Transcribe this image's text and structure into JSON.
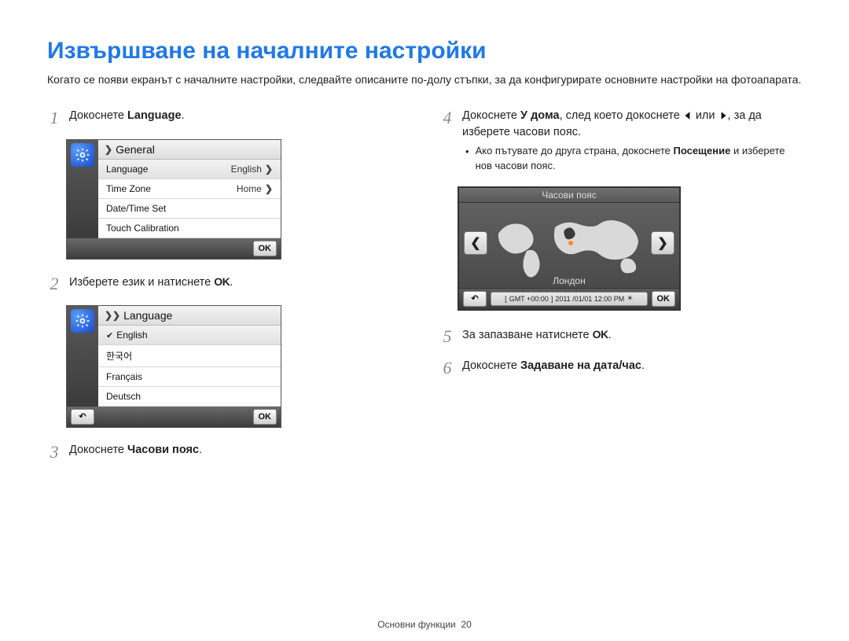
{
  "title": "Извършване на началните настройки",
  "intro": "Когато се появи екранът с началните настройки, следвайте описаните по-долу стъпки, за да конфигурирате основните настройки на фотоапарата.",
  "steps": {
    "s1": {
      "num": "1",
      "pre": "Докоснете ",
      "bold": "Language",
      "post": "."
    },
    "s2": {
      "num": "2",
      "text": "Изберете език и натиснете ",
      "ok": "OK",
      "post": "."
    },
    "s3": {
      "num": "3",
      "pre": "Докоснете ",
      "bold": "Часови пояс",
      "post": "."
    },
    "s4": {
      "num": "4",
      "pre": "Докоснете ",
      "bold": "У дома",
      "mid1": ", след което докоснете ",
      "mid2": " или ",
      "post": ", за да изберете часови пояс."
    },
    "s4b": {
      "pre": "Ако пътувате до друга страна, докоснете ",
      "bold": "Посещение",
      "post": " и изберете нов часови пояс."
    },
    "s5": {
      "num": "5",
      "text": "За запазване натиснете ",
      "ok": "OK",
      "post": "."
    },
    "s6": {
      "num": "6",
      "pre": "Докоснете ",
      "bold": "Задаване на дата/час",
      "post": "."
    }
  },
  "device1": {
    "header": "General",
    "rows": [
      {
        "label": "Language",
        "value": "English"
      },
      {
        "label": "Time Zone",
        "value": "Home"
      },
      {
        "label": "Date/Time Set",
        "value": ""
      },
      {
        "label": "Touch Calibration",
        "value": ""
      }
    ],
    "ok": "OK"
  },
  "device2": {
    "header": "Language",
    "rows": [
      {
        "label": "English",
        "checked": true
      },
      {
        "label": "한국어"
      },
      {
        "label": "Français"
      },
      {
        "label": "Deutsch"
      }
    ],
    "ok": "OK"
  },
  "tz": {
    "header": "Часови пояс",
    "city": "Лондон",
    "gmt": "GMT +00:00",
    "date": "2011 /01/01 12:00 PM",
    "ok": "OK"
  },
  "footer": {
    "section": "Основни функции",
    "page": "20"
  }
}
